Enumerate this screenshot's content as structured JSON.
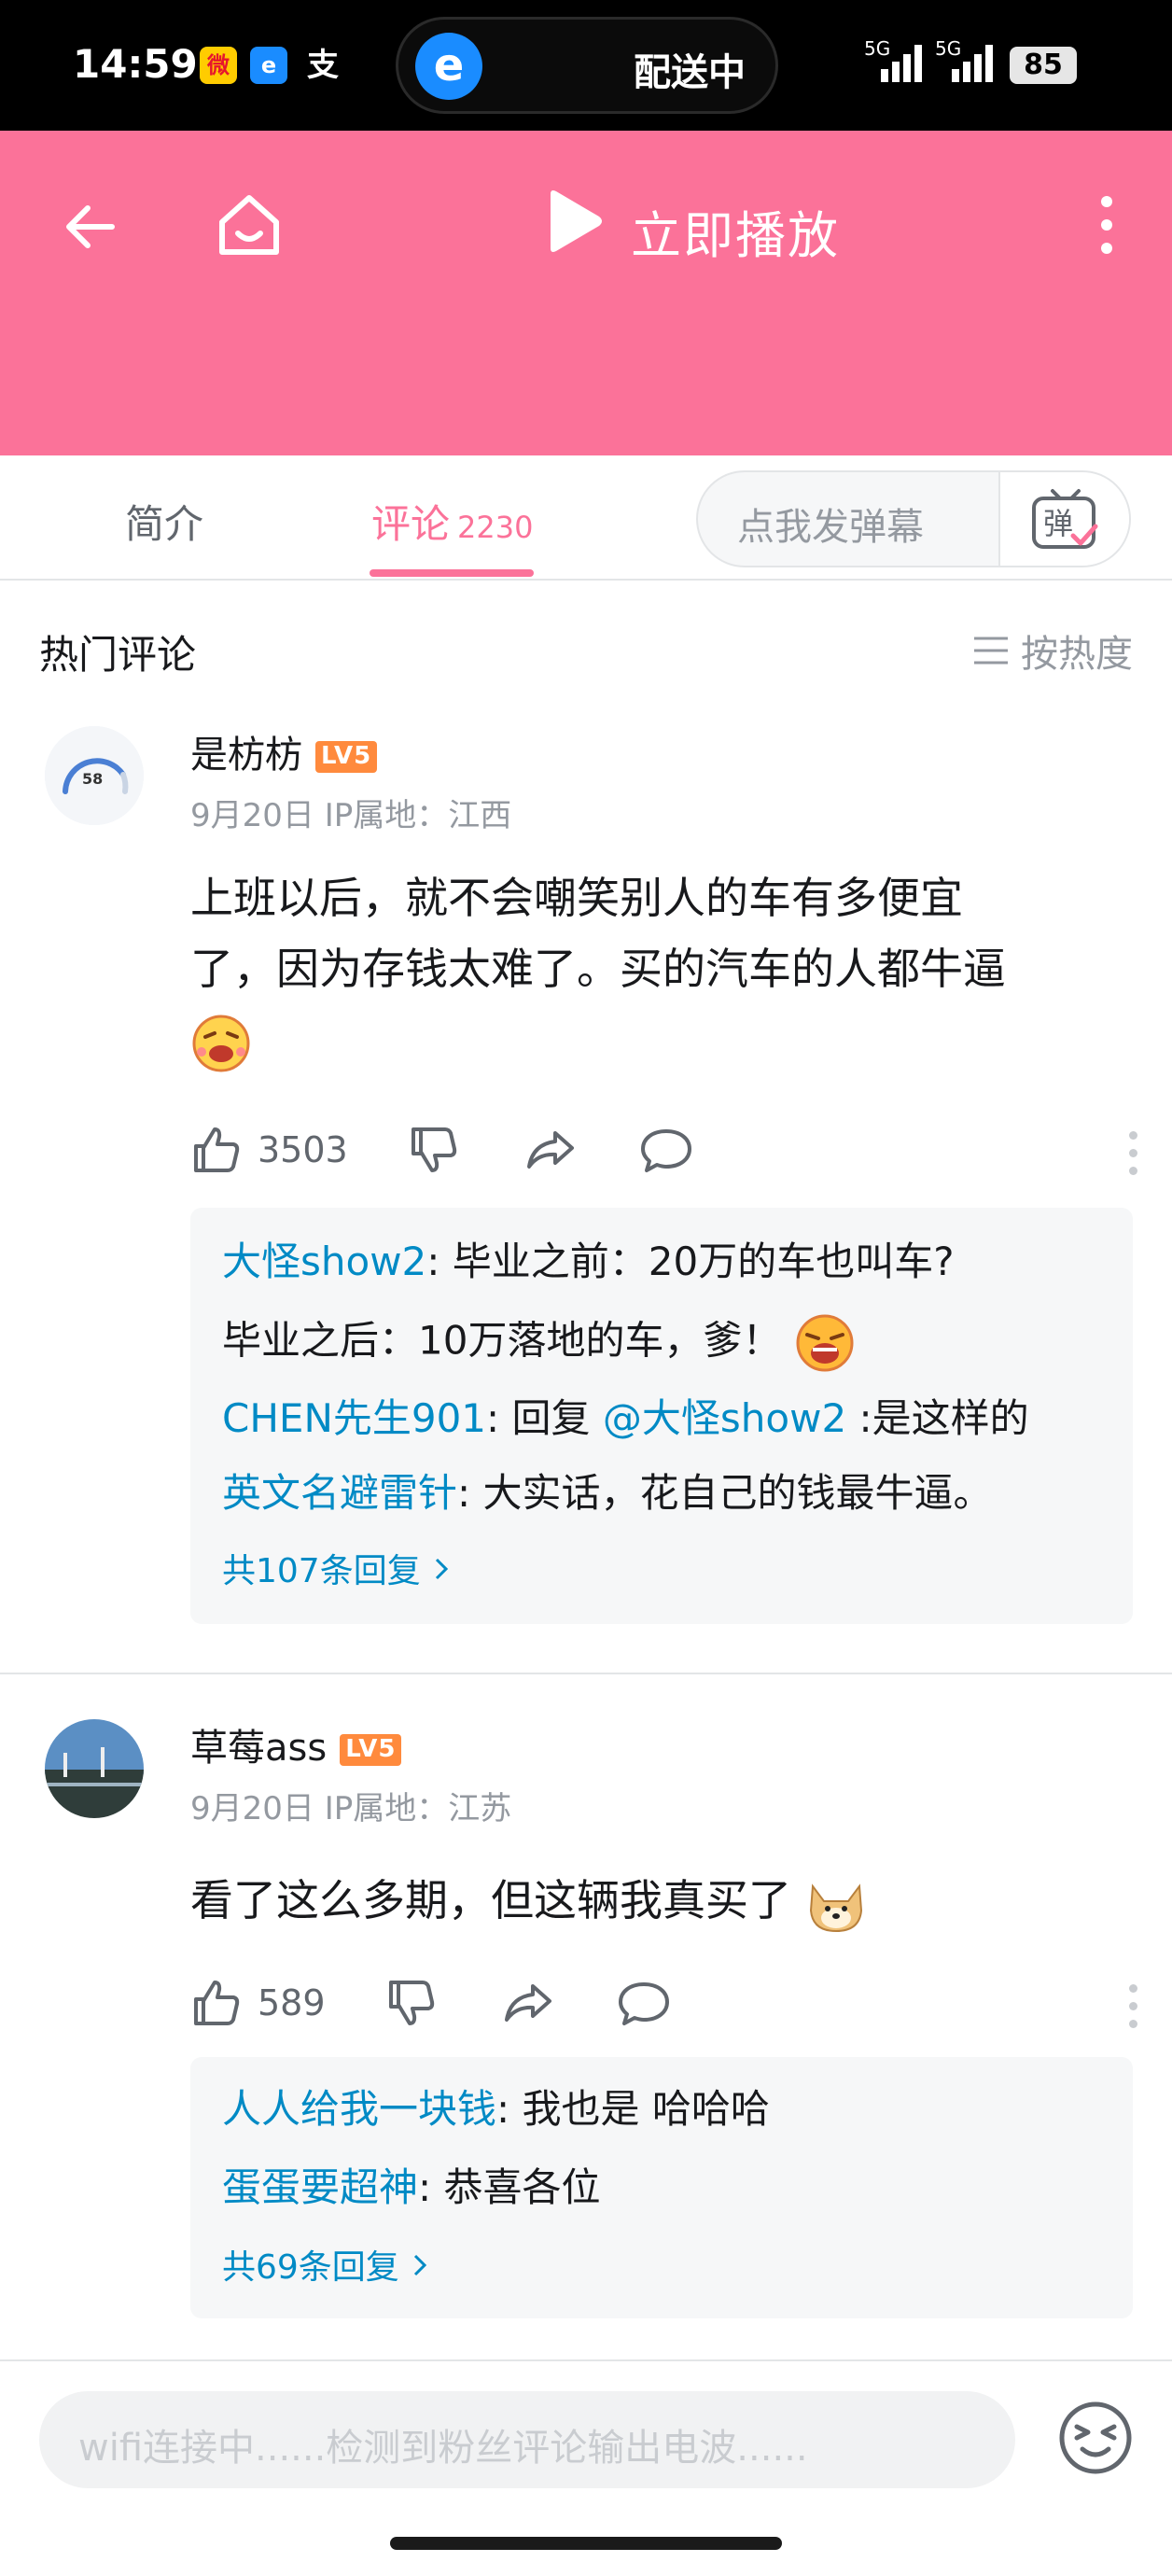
{
  "status_bar": {
    "time": "14:59",
    "pill_text": "配送中",
    "signal_1": "5G",
    "signal_2": "5G",
    "battery": "85"
  },
  "header": {
    "play_label": "立即播放"
  },
  "tabs": {
    "intro_label": "简介",
    "comments_label": "评论",
    "comments_count": "2230",
    "danmu_placeholder": "点我发弹幕",
    "danmu_button_label": "弹"
  },
  "comments_section": {
    "title": "热门评论",
    "sort_label": "按热度"
  },
  "comments": [
    {
      "username": "是枋枋",
      "level": "LV5",
      "avatar_number": "58",
      "date": "9月20日",
      "ip_location": "IP属地：江西",
      "text_line_1": "上班以后，就不会嘲笑别人的车有多便宜",
      "text_line_2": "了，因为存钱太难了。买的汽车的人都牛逼",
      "likes": "3503",
      "replies": [
        {
          "name": "大怪show2",
          "text": ": 毕业之前：20万的车也叫车?"
        },
        {
          "name": "",
          "text": "毕业之后：10万落地的车，爹！"
        },
        {
          "name": "CHEN先生901",
          "text": ": 回复 ",
          "mention": "@大怪show2",
          "tail": " :是这样的"
        },
        {
          "name": "英文名避雷针",
          "text": ": 大实话，花自己的钱最牛逼。"
        }
      ],
      "reply_total": "共107条回复"
    },
    {
      "username": "草莓ass",
      "level": "LV5",
      "date": "9月20日",
      "ip_location": "IP属地：江苏",
      "text_line_1": "看了这么多期，但这辆我真买了",
      "likes": "589",
      "replies": [
        {
          "name": "人人给我一块钱",
          "text": ": 我也是 哈哈哈"
        },
        {
          "name": "蛋蛋要超神",
          "text": ": 恭喜各位"
        }
      ],
      "reply_total": "共69条回复"
    }
  ],
  "input_bar": {
    "placeholder": "wifi连接中......检测到粉丝评论输出电波......"
  },
  "colors": {
    "brand_pink": "#fb7299",
    "link_blue": "#008ac5",
    "level_orange": "#ff8a3d"
  }
}
